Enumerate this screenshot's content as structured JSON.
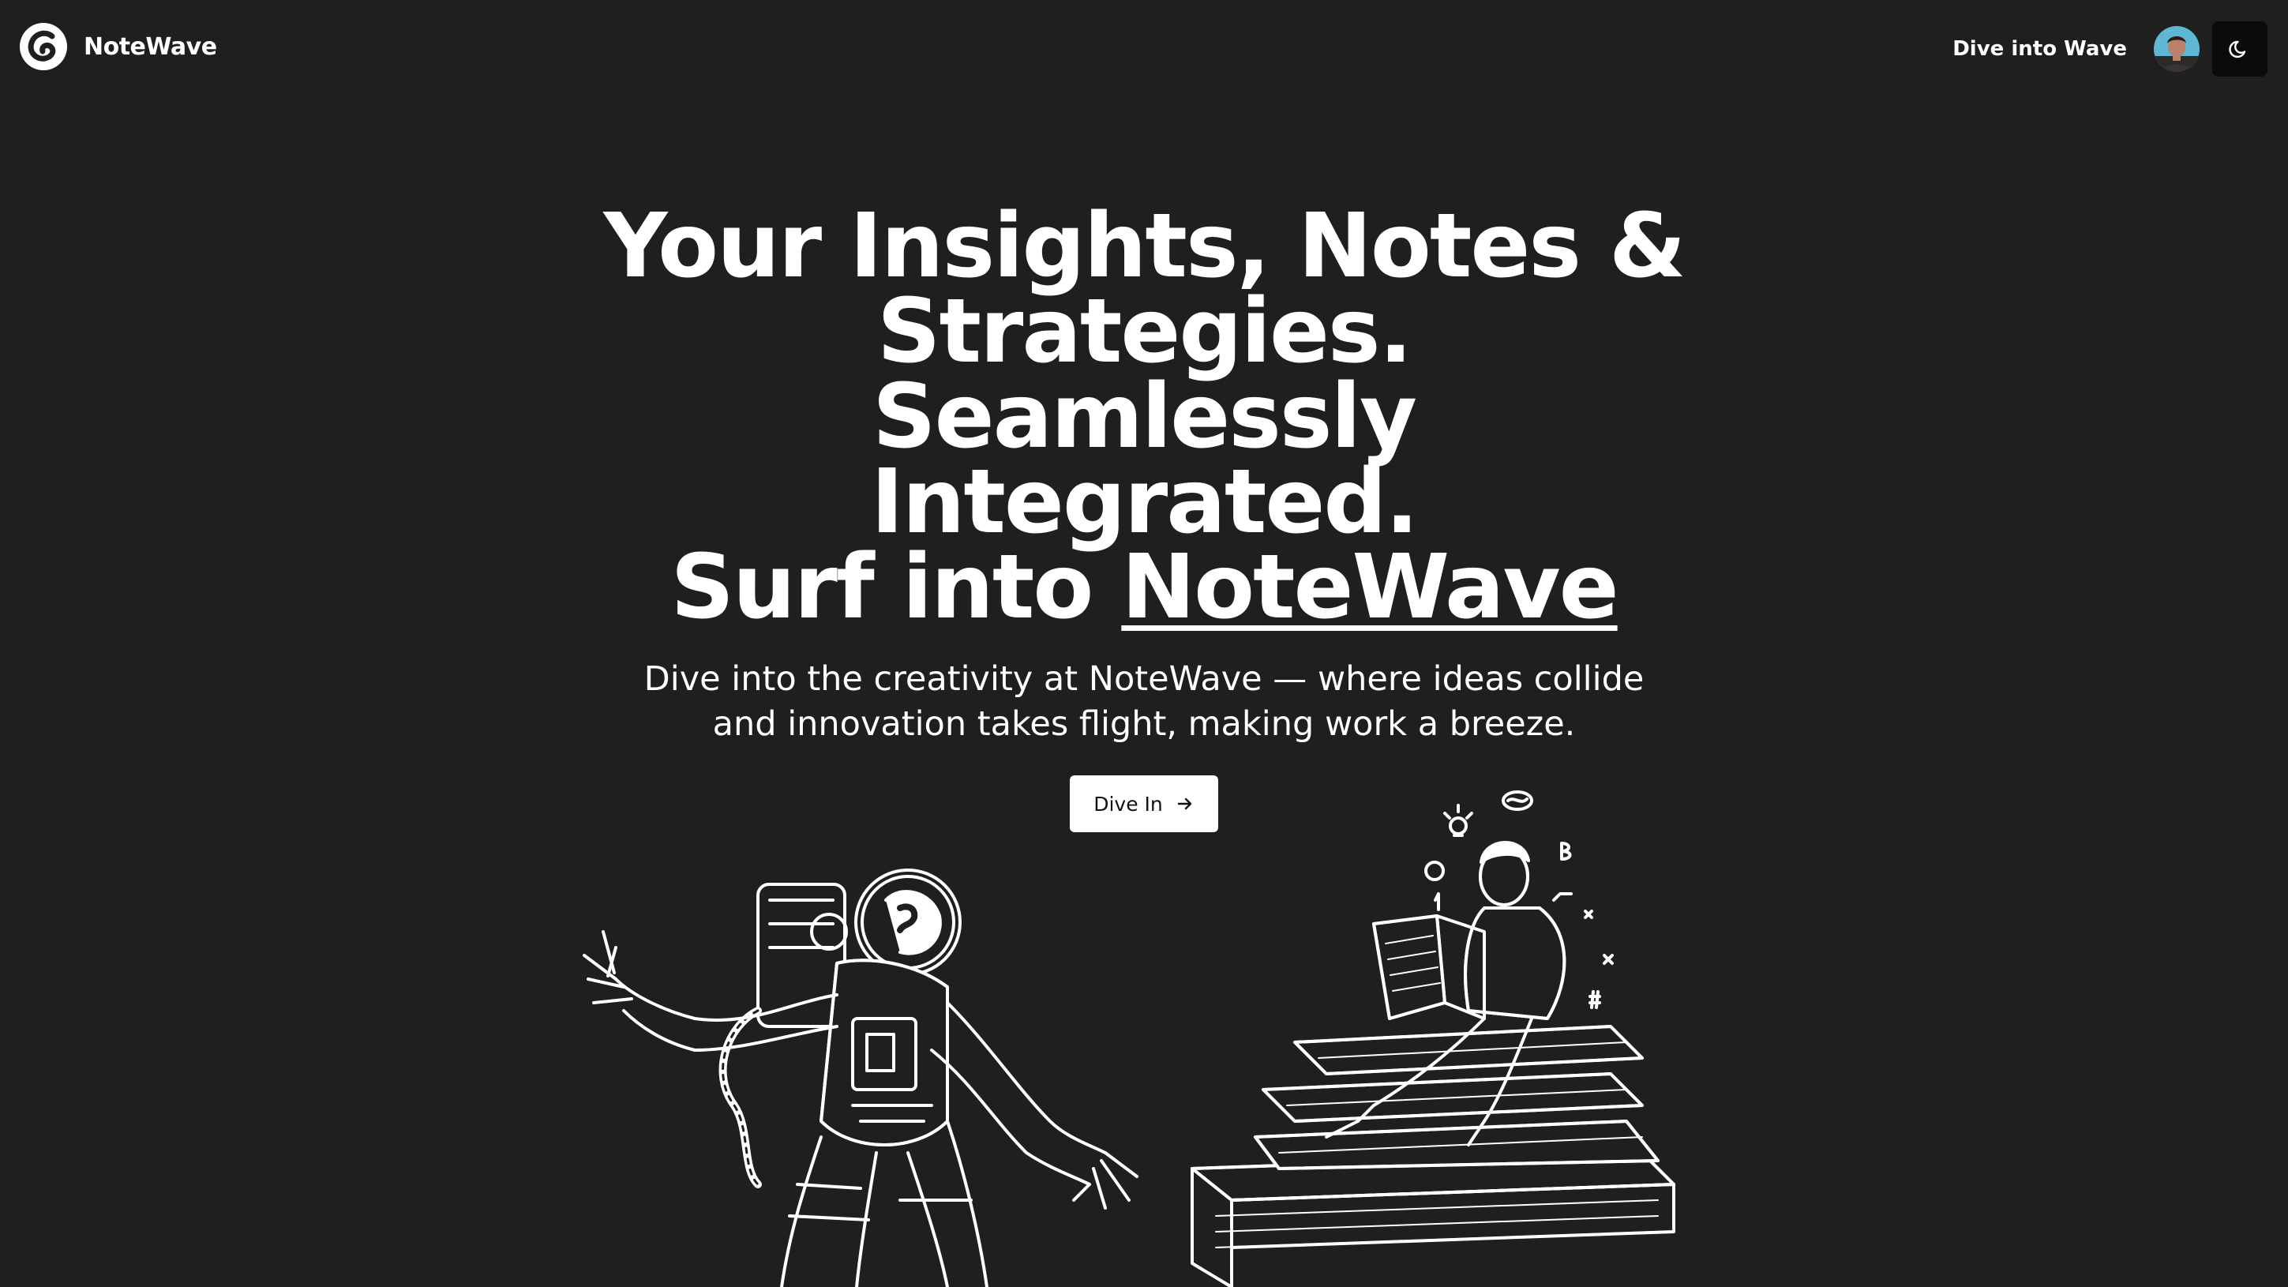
{
  "header": {
    "brand_name": "NoteWave",
    "nav_link": "Dive into Wave",
    "avatar_icon": "user-avatar",
    "theme_icon": "moon-icon"
  },
  "hero": {
    "title_line1": "Your Insights, Notes &",
    "title_line2": "Strategies. Seamlessly",
    "title_line3": "Integrated.",
    "title_line4_prefix": "Surf into ",
    "title_line4_brand": "NoteWave",
    "subtitle": "Dive into the creativity at NoteWave — where ideas collide and innovation takes flight, making work a breeze.",
    "cta_label": "Dive In",
    "cta_icon": "arrow-right-icon"
  },
  "illustrations": {
    "left": "astronaut-illustration",
    "right": "reader-on-books-illustration"
  },
  "colors": {
    "background": "#1f1f1f",
    "text": "#ffffff",
    "button_bg": "#ffffff",
    "button_text": "#111111",
    "toggle_bg": "#0b0b0b"
  }
}
